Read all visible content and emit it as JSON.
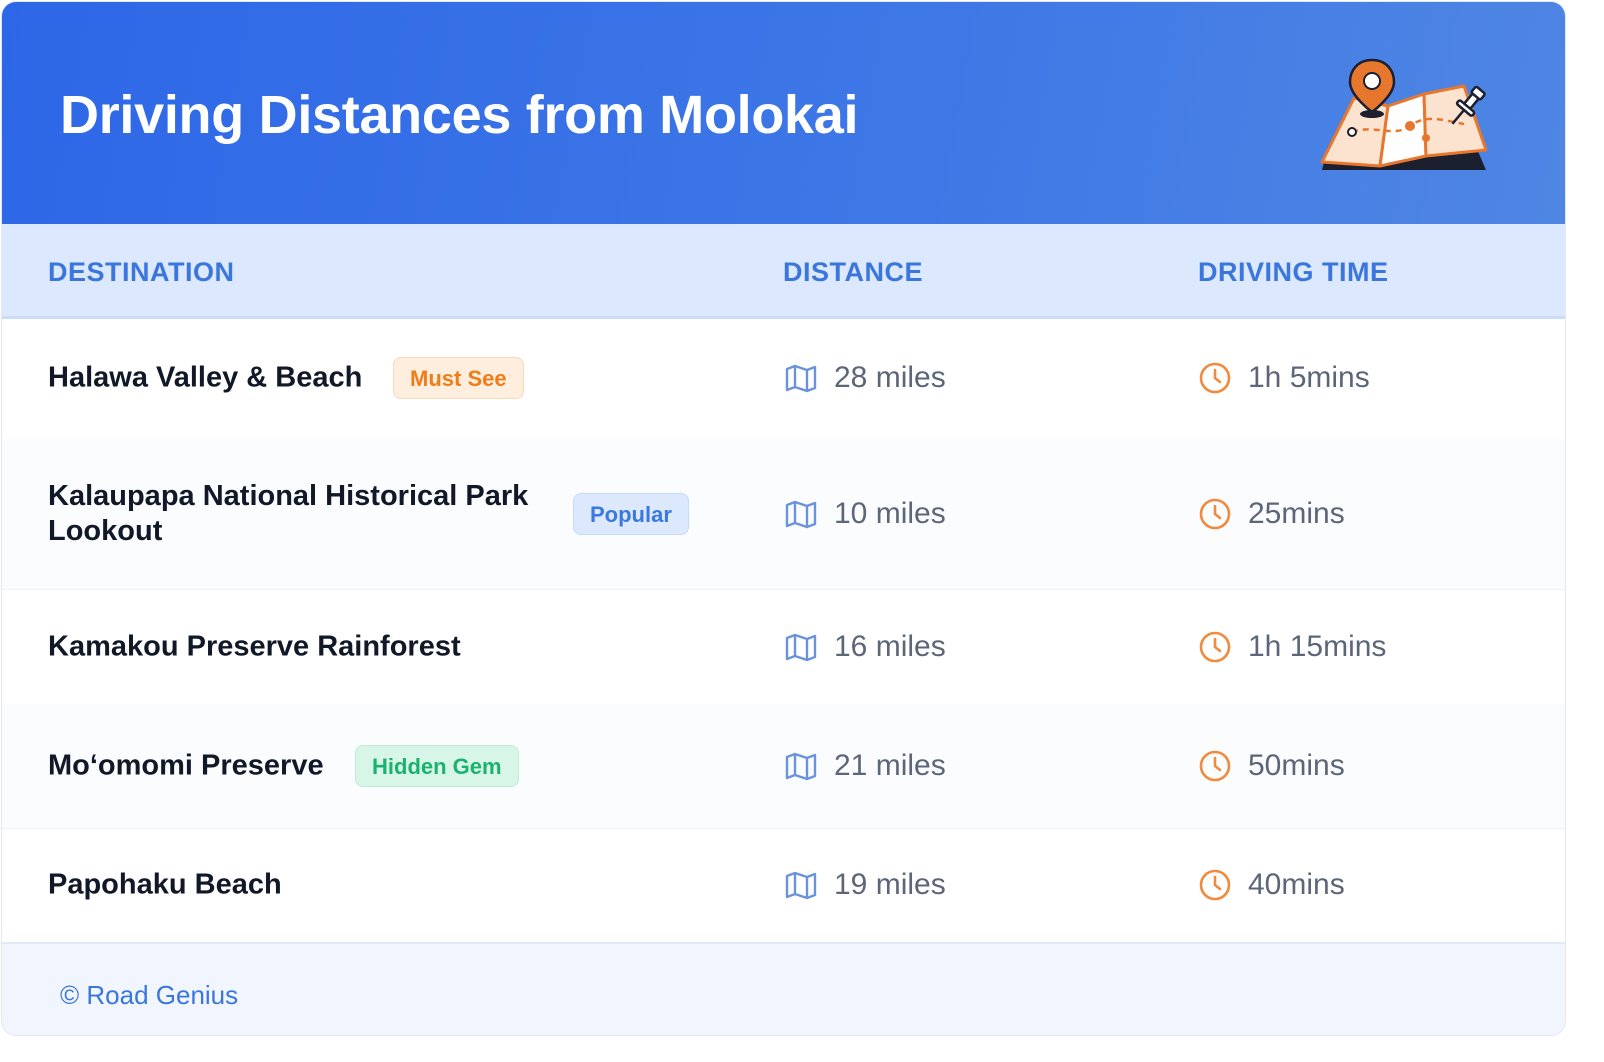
{
  "header": {
    "title": "Driving Distances from Molokai",
    "illustration": "folded-map-with-location-pin-and-pushpin",
    "colors": {
      "gradient_start": "#2d67e7",
      "gradient_end": "#4f86e4"
    }
  },
  "table": {
    "columns": [
      "DESTINATION",
      "DISTANCE",
      "DRIVING TIME"
    ],
    "rows": [
      {
        "destination": "Halawa Valley & Beach",
        "badge": "Must See",
        "badge_color": "orange",
        "distance": "28 miles",
        "time": "1h 5mins"
      },
      {
        "destination": "Kalaupapa National Historical Park Lookout",
        "badge": "Popular",
        "badge_color": "blue",
        "distance": "10 miles",
        "time": "25mins"
      },
      {
        "destination": "Kamakou Preserve Rainforest",
        "badge": "",
        "badge_color": "",
        "distance": "16 miles",
        "time": "1h 15mins"
      },
      {
        "destination": "Mo‘omomi Preserve",
        "badge": "Hidden Gem",
        "badge_color": "green",
        "distance": "21 miles",
        "time": "50mins"
      },
      {
        "destination": "Papohaku Beach",
        "badge": "",
        "badge_color": "",
        "distance": "19 miles",
        "time": "40mins"
      }
    ],
    "icons": {
      "distance": "map-icon",
      "time": "clock-icon"
    },
    "colors": {
      "accent": "#3a76dc",
      "clock": "#f08a3c",
      "map": "#6b93dc"
    }
  },
  "footer": {
    "credit": "© Road Genius"
  }
}
